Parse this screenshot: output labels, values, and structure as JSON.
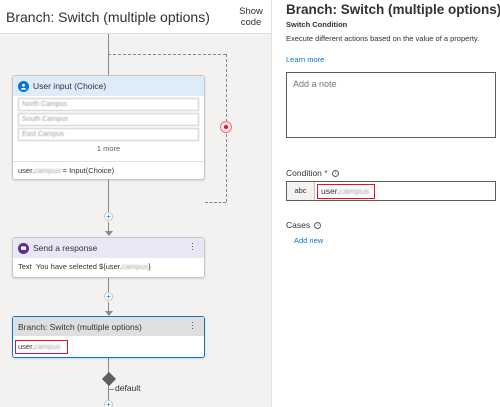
{
  "canvas": {
    "title": "Branch: Switch (multiple options)",
    "show_code": "Show code"
  },
  "nodes": {
    "user_input": {
      "title": "User input (Choice)",
      "options": [
        "North Campus",
        "South Campus",
        "East Campus"
      ],
      "more": "1 more",
      "binding_prefix": "user.",
      "binding_redacted": "campus",
      "binding_suffix": " = Input(Choice)"
    },
    "send_response": {
      "title": "Send a response",
      "text_label": "Text",
      "text_prefix": "You have selected ${user.",
      "text_redacted": "campus",
      "text_suffix": "}"
    },
    "switch": {
      "title": "Branch: Switch (multiple options)",
      "value_prefix": "user.",
      "value_redacted": "campus"
    },
    "default_label": "default"
  },
  "panel": {
    "title": "Branch: Switch (multiple options)",
    "subtitle": "Switch Condition",
    "description": "Execute different actions based on the value of a property.",
    "learn_more": "Learn more",
    "note_placeholder": "Add a note",
    "condition_label": "Condition",
    "condition_required": "*",
    "condition_type": "abc",
    "condition_prefix": "user.",
    "condition_redacted": "campus",
    "cases_label": "Cases",
    "add_new": "Add new"
  },
  "colors": {
    "accent": "#0078d4",
    "highlight_red": "#e81123",
    "user_input_header": "#deecf9",
    "send_response_header": "#ebe6f5",
    "switch_header": "#e1dfdd"
  }
}
